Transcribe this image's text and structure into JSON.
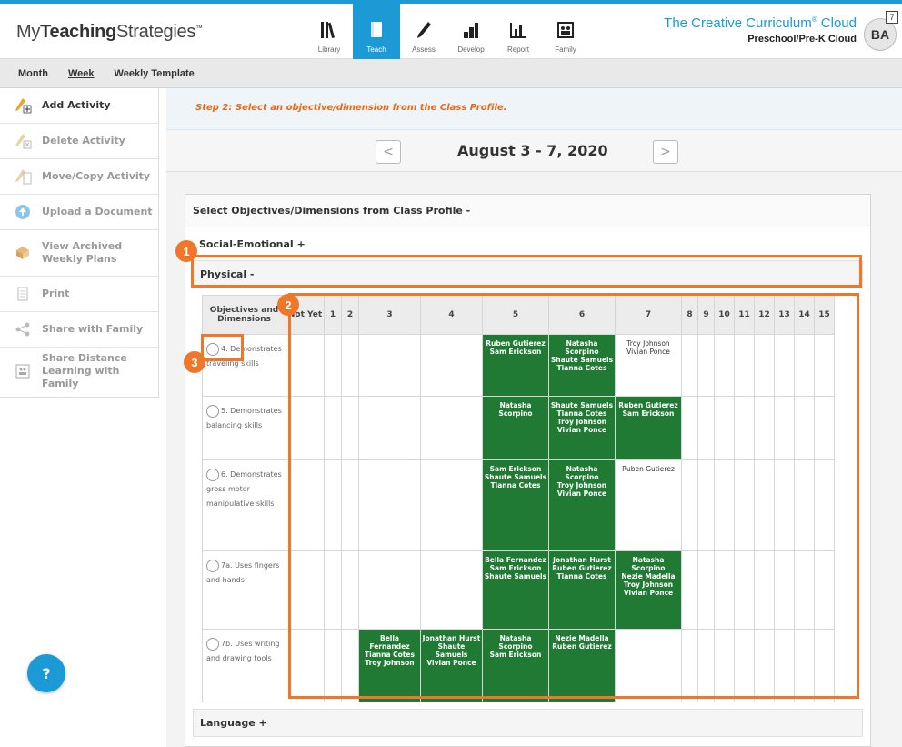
{
  "header": {
    "logo_prefix": "My",
    "logo_bold": "Teaching",
    "logo_suffix": "Strategies",
    "logo_tm": "™",
    "brand_title": "The Creative Curriculum",
    "brand_registered": "®",
    "brand_cloud": "Cloud",
    "brand_subtitle": "Preschool/Pre-K Cloud",
    "avatar_initials": "BA",
    "notification_count": "7",
    "nav": [
      {
        "label": "Library",
        "icon": "library-icon"
      },
      {
        "label": "Teach",
        "icon": "teach-icon",
        "active": true
      },
      {
        "label": "Assess",
        "icon": "assess-icon"
      },
      {
        "label": "Develop",
        "icon": "develop-icon"
      },
      {
        "label": "Report",
        "icon": "report-icon"
      },
      {
        "label": "Family",
        "icon": "family-icon"
      }
    ],
    "accent_color": "#1b9ad6"
  },
  "subnav": {
    "month": "Month",
    "week": "Week",
    "weekly_template": "Weekly Template"
  },
  "sidebar": {
    "items": [
      {
        "label": "Add Activity",
        "icon": "add-activity-icon"
      },
      {
        "label": "Delete Activity",
        "icon": "delete-activity-icon"
      },
      {
        "label": "Move/Copy Activity",
        "icon": "move-copy-icon"
      },
      {
        "label": "Upload a Document",
        "icon": "upload-icon"
      },
      {
        "label": "View Archived Weekly Plans",
        "icon": "archive-icon"
      },
      {
        "label": "Print",
        "icon": "print-icon"
      },
      {
        "label": "Share with Family",
        "icon": "share-icon"
      },
      {
        "label": "Share Distance Learning with Family",
        "icon": "distance-learning-icon"
      }
    ]
  },
  "help": {
    "label": "?"
  },
  "main": {
    "step_text": "Step 2: Select an objective/dimension from the Class Profile.",
    "date_range": "August 3 - 7, 2020",
    "prev_arrow": "<",
    "next_arrow": ">",
    "panel_title": "Select Objectives/Dimensions from Class Profile  -",
    "sections": {
      "social": "Social-Emotional  +",
      "physical": "Physical  -",
      "language": "Language  +"
    }
  },
  "grid": {
    "headers": [
      "Objectives and Dimensions",
      "Not Yet",
      "1",
      "2",
      "3",
      "4",
      "5",
      "6",
      "7",
      "8",
      "9",
      "10",
      "11",
      "12",
      "13",
      "14",
      "15"
    ],
    "rows": [
      {
        "objective": "4. Demonstrates traveling skills",
        "cells": {
          "5": [
            "Ruben Gutierez",
            "Sam Erickson"
          ],
          "6": [
            "Natasha Scorpino",
            "Shaute Samuels",
            "Tianna Cotes"
          ],
          "7": [
            "Troy Johnson",
            "Vivian Ponce"
          ]
        }
      },
      {
        "objective": "5. Demonstrates balancing skills",
        "cells": {
          "5": [
            "Natasha Scorpino"
          ],
          "6": [
            "Shaute Samuels",
            "Tianna Cotes",
            "Troy Johnson",
            "Vivian Ponce"
          ],
          "7": [
            "Ruben Gutierez",
            "Sam Erickson"
          ]
        }
      },
      {
        "objective": "6. Demonstrates gross motor manipulative skills",
        "cells": {
          "5": [
            "Sam Erickson",
            "Shaute Samuels",
            "Tianna Cotes"
          ],
          "6": [
            "Natasha Scorpino",
            "Troy Johnson",
            "Vivian Ponce"
          ],
          "7": [
            "Ruben Gutierez"
          ]
        }
      },
      {
        "objective": "7a. Uses fingers and hands",
        "cells": {
          "5": [
            "Bella Fernandez",
            "Sam Erickson",
            "Shaute Samuels"
          ],
          "6": [
            "Jonathan Hurst",
            "Ruben Gutierez",
            "Tianna Cotes"
          ],
          "7": [
            "Natasha Scorpino",
            "Nezie Madella",
            "Troy Johnson",
            "Vivian Ponce"
          ]
        }
      },
      {
        "objective": "7b. Uses writing and drawing tools",
        "cells": {
          "3": [
            "Bella Fernandez",
            "Tianna Cotes",
            "Troy Johnson"
          ],
          "4": [
            "Jonathan Hurst",
            "Shaute Samuels",
            "Vivian Ponce"
          ],
          "5": [
            "Natasha Scorpino",
            "Sam Erickson"
          ],
          "6": [
            "Nezie Madella",
            "Ruben Gutierez"
          ]
        }
      }
    ],
    "highlight_color": "#217a34"
  },
  "annotations": {
    "one": "1",
    "two": "2",
    "three": "3",
    "color": "#f0762a"
  }
}
